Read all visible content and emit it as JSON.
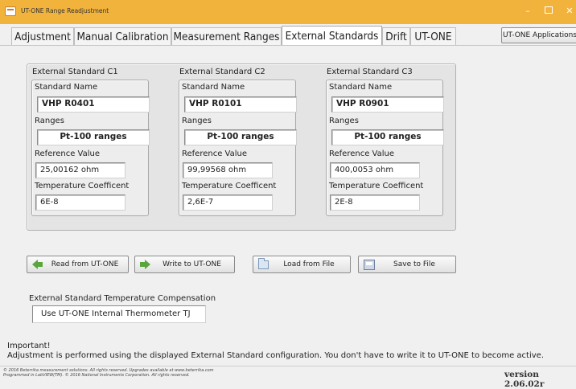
{
  "window": {
    "title": "UT-ONE Range Readjustment",
    "min": "–",
    "max_icon": "maximize-icon",
    "close": "✕"
  },
  "tabs": [
    {
      "label": "Adjustment",
      "active": false
    },
    {
      "label": "Manual Calibration",
      "active": false
    },
    {
      "label": "Measurement Ranges",
      "active": false
    },
    {
      "label": "External Standards",
      "active": true
    },
    {
      "label": "Drift",
      "active": false
    },
    {
      "label": "UT-ONE",
      "active": false
    }
  ],
  "apps_button": "UT-ONE Applications",
  "standards": [
    {
      "title": "External Standard C1",
      "name_label": "Standard Name",
      "name": "VHP R0401",
      "ranges_label": "Ranges",
      "ranges": "Pt-100 ranges",
      "ref_label": "Reference Value",
      "ref": "25,00162 ohm",
      "tc_label": "Temperature Coefficent",
      "tc": "6E-8"
    },
    {
      "title": "External Standard C2",
      "name_label": "Standard Name",
      "name": "VHP R0101",
      "ranges_label": "Ranges",
      "ranges": "Pt-100 ranges",
      "ref_label": "Reference Value",
      "ref": "99,99568 ohm",
      "tc_label": "Temperature Coefficent",
      "tc": "2,6E-7"
    },
    {
      "title": "External Standard C3",
      "name_label": "Standard Name",
      "name": "VHP R0901",
      "ranges_label": "Ranges",
      "ranges": "Pt-100 ranges",
      "ref_label": "Reference Value",
      "ref": "400,0053 ohm",
      "tc_label": "Temperature Coefficent",
      "tc": "2E-8"
    }
  ],
  "buttons": {
    "read": "Read from UT-ONE",
    "write": "Write to UT-ONE",
    "load": "Load from File",
    "save": "Save to File"
  },
  "compensation": {
    "label": "External Standard Temperature Compensation",
    "value": "Use UT-ONE Internal Thermometer TJ"
  },
  "note": {
    "title": "Important!",
    "text": "Adjustment is performed using the displayed External Standard configuration. You don't have to write it to UT-ONE to become active."
  },
  "footer": {
    "copyright_1": "© 2016 Beterrika measurement solutions. All rights reserved. Upgrades available at www.beterrika.com",
    "copyright_2": "Programmed in LabVIEW(TM). © 2016 National Instruments Corporation. All rights reserved.",
    "version": "version 2.06.02r"
  },
  "colors": {
    "titlebar": "#f2b33d",
    "accent_icon": "#5aa53c"
  }
}
